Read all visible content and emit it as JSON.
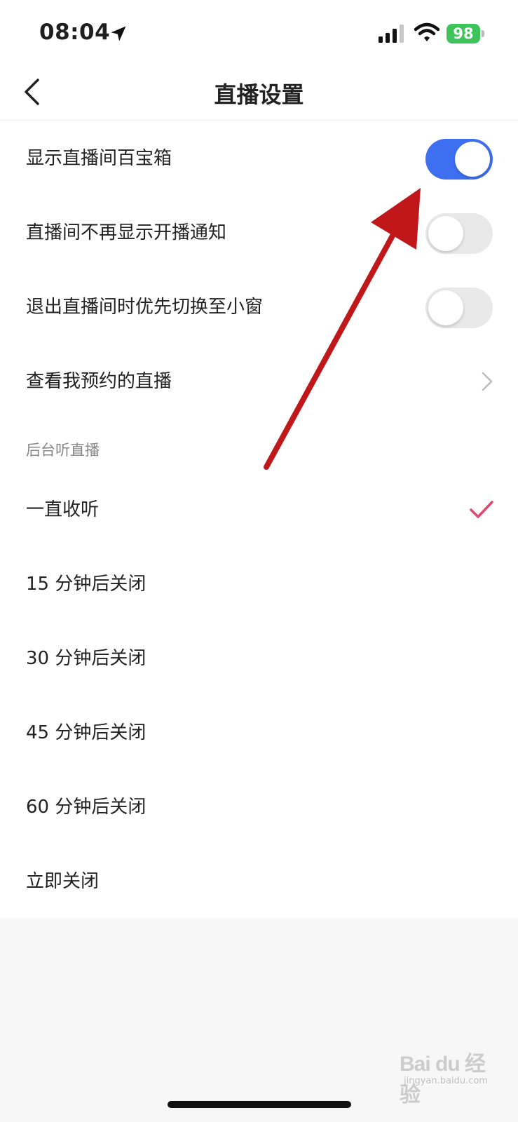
{
  "status_bar": {
    "time": "08:04",
    "battery": "98"
  },
  "nav": {
    "title": "直播设置"
  },
  "settings": {
    "show_treasure_box": {
      "label": "显示直播间百宝箱",
      "enabled": true
    },
    "hide_start_notice": {
      "label": "直播间不再显示开播通知",
      "enabled": false
    },
    "prefer_mini_window": {
      "label": "退出直播间时优先切换至小窗",
      "enabled": false
    },
    "my_reservations": {
      "label": "查看我预约的直播"
    }
  },
  "background_listen": {
    "header": "后台听直播",
    "options": [
      {
        "label": "一直收听",
        "selected": true
      },
      {
        "label": "15 分钟后关闭",
        "selected": false
      },
      {
        "label": "30 分钟后关闭",
        "selected": false
      },
      {
        "label": "45 分钟后关闭",
        "selected": false
      },
      {
        "label": "60 分钟后关闭",
        "selected": false
      },
      {
        "label": "立即关闭",
        "selected": false
      }
    ]
  },
  "watermark": {
    "logo": "Bai du 经验",
    "url": "jingyan.baidu.com"
  },
  "colors": {
    "toggle_on": "#3e6ff1",
    "check": "#e0476f",
    "arrow": "#c0171b"
  },
  "icons": [
    "location-arrow-icon",
    "signal-icon",
    "wifi-icon",
    "battery-icon",
    "back-icon",
    "chevron-right-icon",
    "checkmark-icon"
  ]
}
